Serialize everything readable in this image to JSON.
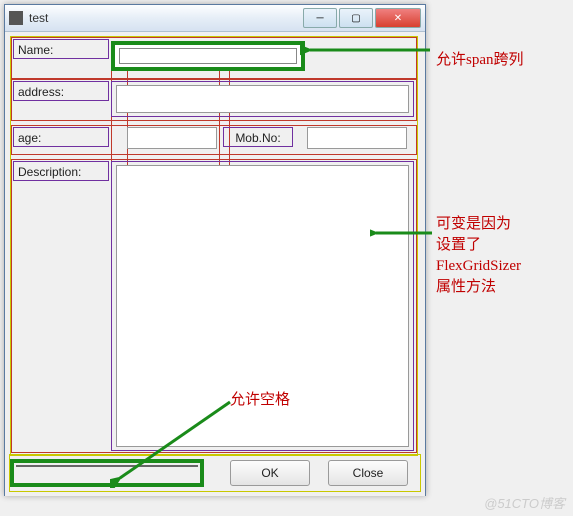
{
  "window": {
    "title": "test"
  },
  "labels": {
    "name": "Name:",
    "address": "address:",
    "age": "age:",
    "mobno": "Mob.No:",
    "description": "Description:"
  },
  "fields": {
    "name": "",
    "address": "",
    "age": "",
    "mobno": "",
    "description": ""
  },
  "buttons": {
    "ok": "OK",
    "close": "Close"
  },
  "annotations": {
    "span": "允许span跨列",
    "flex": "可变是因为\n设置了\nFlexGridSizer\n属性方法",
    "space": "允许空格"
  },
  "watermark": "@51CTO博客"
}
